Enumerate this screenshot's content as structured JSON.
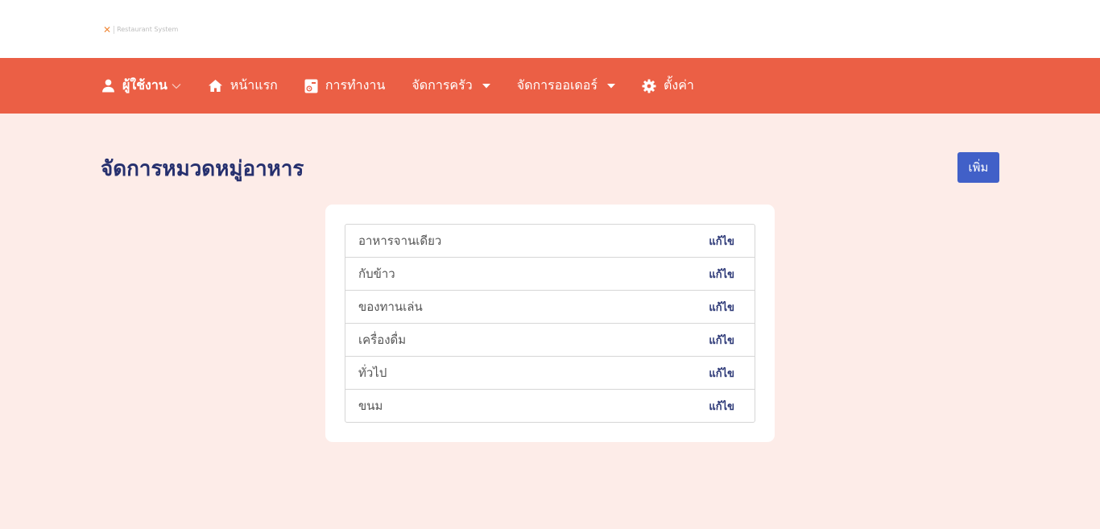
{
  "logo": {
    "mark": "✕",
    "text": "Restaurant System"
  },
  "nav": {
    "user": "ผู้ใช้งาน",
    "home": "หน้าแรก",
    "work": "การทำงาน",
    "kitchen": "จัดการครัว",
    "orders": "จัดการออเดอร์",
    "settings": "ตั้งค่า"
  },
  "page": {
    "title": "จัดการหมวดหมู่อาหาร",
    "add_label": "เพิ่ม"
  },
  "categories": [
    {
      "name": "อาหารจานเดียว",
      "edit": "แก้ไข"
    },
    {
      "name": "กับข้าว",
      "edit": "แก้ไข"
    },
    {
      "name": "ของทานเล่น",
      "edit": "แก้ไข"
    },
    {
      "name": "เครื่องดื่ม",
      "edit": "แก้ไข"
    },
    {
      "name": "ทั่วไป",
      "edit": "แก้ไข"
    },
    {
      "name": "ขนม",
      "edit": "แก้ไข"
    }
  ],
  "colors": {
    "navbar": "#eb5f45",
    "background": "#fdece8",
    "title": "#26306e",
    "button": "#4160c8"
  }
}
